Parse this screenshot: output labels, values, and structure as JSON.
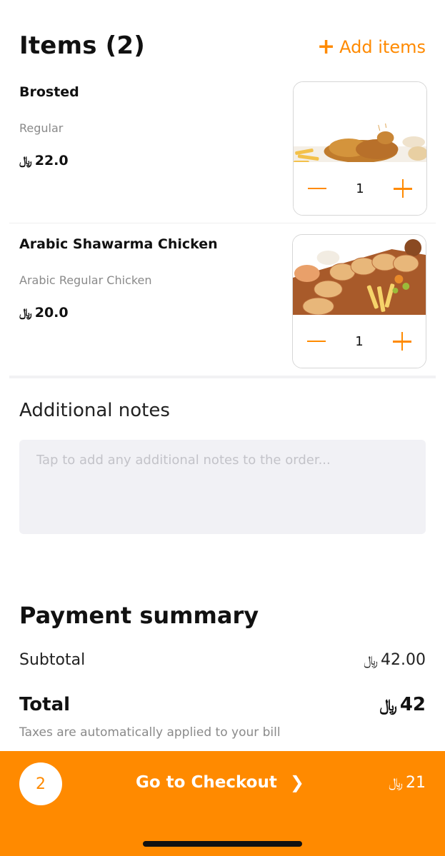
{
  "header": {
    "title": "Items (2)",
    "add_items_label": "Add items"
  },
  "currency_symbol": "⃁",
  "items": [
    {
      "name": "Brosted",
      "variant": "Regular",
      "price": "22.0",
      "quantity": "1"
    },
    {
      "name": "Arabic Shawarma Chicken",
      "variant": "Arabic Regular Chicken",
      "price": "20.0",
      "quantity": "1"
    }
  ],
  "notes": {
    "title": "Additional notes",
    "placeholder": "Tap to add any additional notes to the order..."
  },
  "payment": {
    "title": "Payment summary",
    "subtotal_label": "Subtotal",
    "subtotal_value": "42.00",
    "total_label": "Total",
    "total_value": "42",
    "tax_note": "Taxes are automatically applied to your bill"
  },
  "checkout": {
    "count": "2",
    "label": "Go to Checkout",
    "amount": "21"
  },
  "colors": {
    "accent": "#ff8a00"
  }
}
